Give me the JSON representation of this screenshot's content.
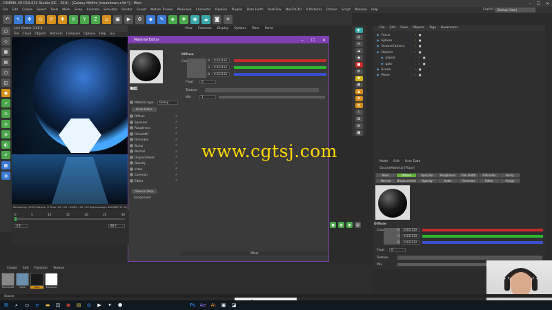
{
  "window": {
    "title": "CINEMA 4D R19.024 Studio (RC - R19) - [Galaxy Hitfilm_breakdown.c4d *] - Main"
  },
  "menubar": [
    "File",
    "Edit",
    "Create",
    "Select",
    "Tools",
    "Mesh",
    "Snap",
    "Animate",
    "Simulate",
    "Render",
    "Sculpt",
    "Motion Tracker",
    "MoGraph",
    "Character",
    "Pipeline",
    "Plugins",
    "Dem Earth",
    "RealFlow",
    "MaxToC4D",
    "X-Particles",
    "Octane",
    "Script",
    "Window",
    "Help"
  ],
  "layout": {
    "label": "Layout:",
    "value": "Startup (User)"
  },
  "viewport": {
    "title": "Live Viewer 3.06.2",
    "menu": [
      "File",
      "Cloud",
      "Objects",
      "Material",
      "Compare",
      "Options",
      "Help",
      "Gui"
    ],
    "status": "Rendering: 100%  Ms/sec: 0  Time: 00 : 00 : 04/00 : 00 : 04  Spp/maxspp: 800/800  Tri: 0/..."
  },
  "viewport_top_menu": [
    "View",
    "Cameras",
    "Display",
    "Options",
    "Filter",
    "Panel"
  ],
  "material_editor": {
    "title": "Material Editor",
    "name": "Floor",
    "material_type_label": "Material type",
    "material_type_value": "Glossy",
    "node_editor": "Node Editor",
    "channels": [
      {
        "name": "Diffuse",
        "checked": true
      },
      {
        "name": "Specular",
        "checked": true
      },
      {
        "name": "Roughness",
        "checked": true
      },
      {
        "name": "Filmwidth",
        "checked": true
      },
      {
        "name": "Filmindex",
        "checked": true
      },
      {
        "name": "Bump",
        "checked": true
      },
      {
        "name": "Normal",
        "checked": true
      },
      {
        "name": "Displacement",
        "checked": true
      },
      {
        "name": "Opacity",
        "checked": true
      },
      {
        "name": "Index",
        "checked": true
      },
      {
        "name": "Common",
        "checked": true
      },
      {
        "name": "Editor",
        "checked": true
      }
    ],
    "show_in_help": "Show in Help",
    "assignment": "Assignment",
    "section": "Diffuse",
    "color_label": "Color",
    "r": "0.031133",
    "g": "0.031133",
    "b": "0.031133",
    "float_label": "Float",
    "float_value": "0",
    "texture_label": "Texture",
    "mix_label": "Mix",
    "mix_value": "1",
    "footer": "Offset"
  },
  "object_manager": {
    "menu": [
      "File",
      "Edit",
      "View",
      "Objects",
      "Tags",
      "Bookmarks"
    ],
    "rows": [
      {
        "name": "Focus",
        "indent": 0,
        "color": "#cfcfcf"
      },
      {
        "name": "Sphere",
        "indent": 0,
        "color": "#cfcfcf"
      },
      {
        "name": "OctaneCamera",
        "indent": 0,
        "color": "#cfcfcf"
      },
      {
        "name": "Objects",
        "indent": 0,
        "color": "#cfcfcf"
      },
      {
        "name": "planet",
        "indent": 1,
        "color": "#cfcfcf"
      },
      {
        "name": "gate",
        "indent": 1,
        "color": "#cfcfcf"
      },
      {
        "name": "Scene",
        "indent": 0,
        "color": "#cfcfcf"
      },
      {
        "name": "Plane",
        "indent": 0,
        "color": "#cfcfcf"
      }
    ]
  },
  "attributes": {
    "menu": [
      "Mode",
      "Edit",
      "User Data"
    ],
    "title": "OctaneMaterial [Floor]",
    "tabs_row1": [
      "Basic",
      "Diffuse",
      "Specular",
      "Roughness",
      "Film Width",
      "Filmindex",
      "Bump"
    ],
    "tabs_row2": [
      "Normal",
      "Displacement",
      "Opacity",
      "Index",
      "Common",
      "Editor",
      "Assign"
    ],
    "active_tab": "Diffuse",
    "section": "Diffuse",
    "color_label": "Color",
    "r": "0.031133",
    "g": "0.031133",
    "b": "0.031133",
    "float_label": "Float",
    "float_value": "0",
    "texture_label": "Texture",
    "mix_label": "Mix"
  },
  "timeline": {
    "ticks": [
      "0",
      "5",
      "10",
      "15",
      "20",
      "25",
      "30"
    ],
    "frame": "0 F",
    "end": "90 F"
  },
  "material_shelf": {
    "menu": [
      "Create",
      "Edit",
      "Function",
      "Texture"
    ],
    "materials": [
      {
        "name": "ParticlesM",
        "color": "#888888"
      },
      {
        "name": "Gate",
        "color": "#6a8fb0"
      },
      {
        "name": "Floor",
        "color": "#1a1a1a"
      },
      {
        "name": "Emissive",
        "color": "#ffffff"
      }
    ]
  },
  "watermark": "www.cgtsj.com",
  "taskbar_popup": {
    "title": "Видео"
  },
  "bottom_bar": {
    "label": "Octane"
  },
  "colors": {
    "accent": "#7e3fb0",
    "active_tab": "#5fb33a",
    "r": "#c62a2a",
    "g": "#2fb62f",
    "b": "#3a4fd0"
  }
}
